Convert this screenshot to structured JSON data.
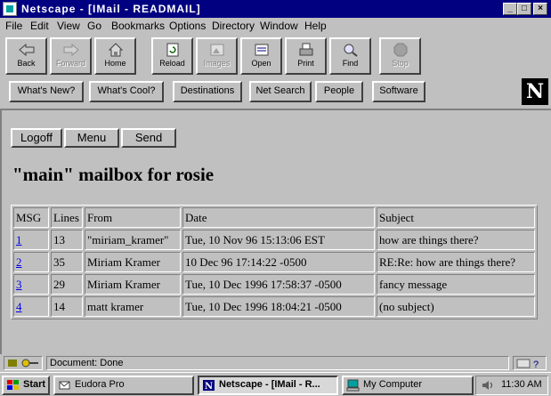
{
  "window": {
    "title": "Netscape - [IMail - READMAIL]"
  },
  "menu": [
    "File",
    "Edit",
    "View",
    "Go",
    "Bookmarks",
    "Options",
    "Directory",
    "Window",
    "Help"
  ],
  "toolbar": [
    {
      "label": "Back",
      "icon": "back-arrow-icon",
      "enabled": true
    },
    {
      "label": "Forward",
      "icon": "forward-arrow-icon",
      "enabled": false
    },
    {
      "label": "Home",
      "icon": "home-icon",
      "enabled": true
    },
    {
      "label": "Reload",
      "icon": "reload-icon",
      "enabled": true
    },
    {
      "label": "Images",
      "icon": "images-icon",
      "enabled": false
    },
    {
      "label": "Open",
      "icon": "open-icon",
      "enabled": true
    },
    {
      "label": "Print",
      "icon": "print-icon",
      "enabled": true
    },
    {
      "label": "Find",
      "icon": "find-icon",
      "enabled": true
    },
    {
      "label": "Stop",
      "icon": "stop-icon",
      "enabled": false
    }
  ],
  "directory_buttons": [
    "What's New?",
    "What's Cool?",
    "Destinations",
    "Net Search",
    "People",
    "Software"
  ],
  "logo": "N",
  "page": {
    "buttons": [
      "Logoff",
      "Menu",
      "Send"
    ],
    "heading": "\"main\" mailbox for rosie",
    "columns": [
      "MSG",
      "Lines",
      "From",
      "Date",
      "Subject"
    ],
    "rows": [
      {
        "msg": "1",
        "lines": "13",
        "from": "\"miriam_kramer\"",
        "date": "Tue, 10 Nov 96 15:13:06 EST",
        "subject": "how are things there?"
      },
      {
        "msg": "2",
        "lines": "35",
        "from": "Miriam Kramer",
        "date": "10 Dec 96 17:14:22 -0500",
        "subject": "RE:Re: how are things there?"
      },
      {
        "msg": "3",
        "lines": "29",
        "from": "Miriam Kramer",
        "date": "Tue, 10 Dec 1996 17:58:37 -0500",
        "subject": "fancy message"
      },
      {
        "msg": "4",
        "lines": "14",
        "from": "matt kramer",
        "date": "Tue, 10 Dec 1996 18:04:21 -0500",
        "subject": "(no subject)"
      }
    ]
  },
  "status": {
    "text": "Document: Done"
  },
  "taskbar": {
    "start": "Start",
    "tasks": [
      {
        "label": "Eudora Pro",
        "active": false
      },
      {
        "label": "Netscape - [IMail - R...",
        "active": true
      },
      {
        "label": "My Computer",
        "active": false
      }
    ],
    "clock": "11:30 AM"
  },
  "colors": {
    "titlebar": "#000080",
    "face": "#c0c0c0",
    "link": "#0000ee"
  }
}
